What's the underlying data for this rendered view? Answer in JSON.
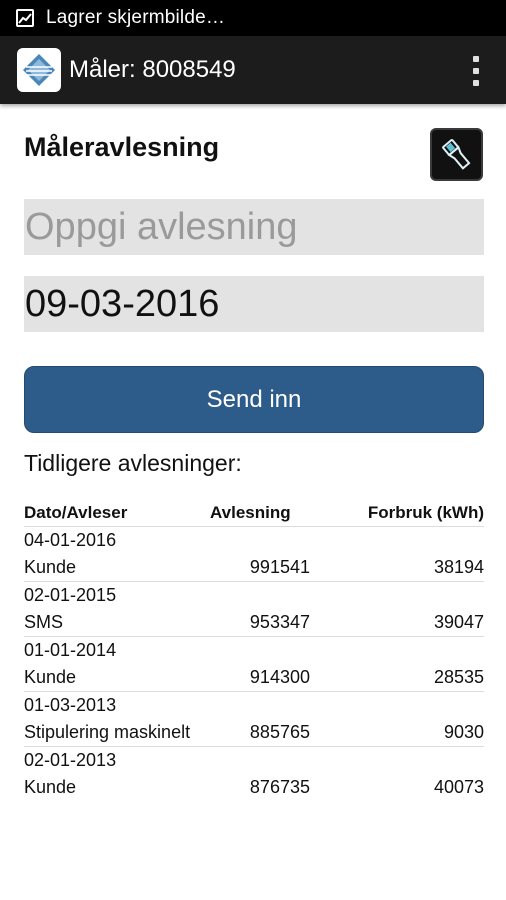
{
  "status_bar": {
    "text": "Lagrer skjermbilde…"
  },
  "action_bar": {
    "title": "Måler: 8008549",
    "logo": "app-logo-icon",
    "menu_icon": "overflow-menu-icon"
  },
  "form": {
    "title": "Måleravlesning",
    "reading_placeholder": "Oppgi avlesning",
    "reading_value": "",
    "date_value": "09-03-2016",
    "submit_label": "Send inn",
    "flashlight_icon": "flashlight-icon"
  },
  "history": {
    "title": "Tidligere avlesninger:",
    "columns": [
      "Dato/Avleser",
      "Avlesning",
      "Forbruk (kWh)"
    ],
    "rows": [
      {
        "date": "04-01-2016",
        "reader": "Kunde",
        "reading": "991541",
        "usage": "38194"
      },
      {
        "date": "02-01-2015",
        "reader": "SMS",
        "reading": "953347",
        "usage": "39047"
      },
      {
        "date": "01-01-2014",
        "reader": "Kunde",
        "reading": "914300",
        "usage": "28535"
      },
      {
        "date": "01-03-2013",
        "reader": "Stipulering maskinelt",
        "reading": "885765",
        "usage": "9030"
      },
      {
        "date": "02-01-2013",
        "reader": "Kunde",
        "reading": "876735",
        "usage": "40073"
      }
    ]
  },
  "colors": {
    "status_bar": "#000000",
    "action_bar": "#1c1c1c",
    "field_bg": "#e3e3e3",
    "button": "#2d5b8a"
  }
}
